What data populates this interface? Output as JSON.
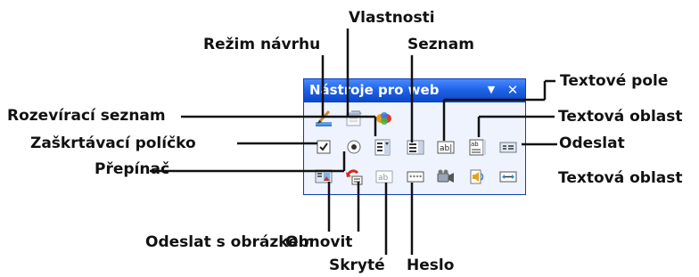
{
  "toolbar": {
    "title": "Nástroje pro web",
    "dropdown_glyph": "▼",
    "close_glyph": "✕",
    "rows": [
      [
        "design-mode-icon",
        "properties-icon",
        "script-editor-icon"
      ],
      [
        "checkbox-icon",
        "option-button-icon",
        "dropdown-box-icon",
        "list-box-icon",
        "textbox-icon",
        "text-area-icon",
        "submit-icon"
      ],
      [
        "submit-with-image-icon",
        "reset-icon",
        "hidden-icon",
        "password-icon",
        "movie-icon",
        "sound-icon",
        "scrolling-text-icon"
      ]
    ]
  },
  "callouts": {
    "rezim_navrhu": "Režim návrhu",
    "vlastnosti": "Vlastnosti",
    "seznam": "Seznam",
    "textove_pole": "Textové pole",
    "rozeviraci_seznam": "Rozevírací seznam",
    "textova_oblast_1": "Textová oblast",
    "zaskrtavaci_policko": "Zaškrtávací políčko",
    "odeslat": "Odeslat",
    "prepinac": "Přepínač",
    "textova_oblast_2": "Textová oblast",
    "odeslat_s_obrazkem": "Odeslat s obrázkem",
    "obnovit": "Obnovit",
    "skryte": "Skryté",
    "heslo": "Heslo"
  },
  "colors": {
    "titlebar": "#1f63e6",
    "toolbar_bg": "#eef3fd",
    "border": "#0a3eb8"
  }
}
